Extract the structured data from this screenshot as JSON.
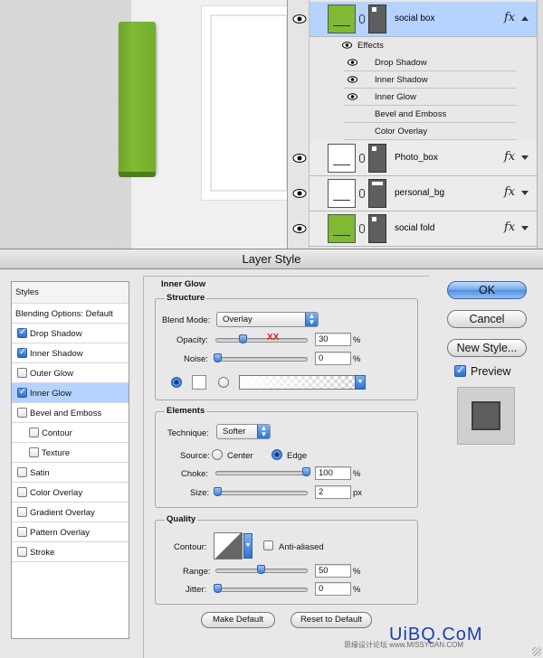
{
  "layers": {
    "rows": [
      {
        "name": "social box",
        "selected": true,
        "thumb": "green",
        "mask": "default",
        "fx": true,
        "arrow": "up"
      },
      {
        "name": "Photo_box",
        "selected": false,
        "thumb": "white",
        "mask": "default",
        "fx": true,
        "arrow": "down"
      },
      {
        "name": "personal_bg",
        "selected": false,
        "thumb": "white",
        "mask": "bg",
        "fx": true,
        "arrow": "down"
      },
      {
        "name": "social fold",
        "selected": false,
        "thumb": "green",
        "mask": "default",
        "fx": true,
        "arrow": "down"
      }
    ],
    "effects_label": "Effects",
    "effects": [
      "Drop Shadow",
      "Inner Shadow",
      "Inner Glow",
      "Bevel and Emboss",
      "Color Overlay"
    ],
    "fx_label": "fx"
  },
  "dialog": {
    "title": "Layer Style",
    "styles_header": "Styles",
    "blending_options": "Blending Options: Default",
    "styles": [
      {
        "label": "Drop Shadow",
        "checked": true,
        "indent": false
      },
      {
        "label": "Inner Shadow",
        "checked": true,
        "indent": false
      },
      {
        "label": "Outer Glow",
        "checked": false,
        "indent": false
      },
      {
        "label": "Inner Glow",
        "checked": true,
        "indent": false,
        "selected": true
      },
      {
        "label": "Bevel and Emboss",
        "checked": false,
        "indent": false
      },
      {
        "label": "Contour",
        "checked": false,
        "indent": true
      },
      {
        "label": "Texture",
        "checked": false,
        "indent": true
      },
      {
        "label": "Satin",
        "checked": false,
        "indent": false
      },
      {
        "label": "Color Overlay",
        "checked": false,
        "indent": false
      },
      {
        "label": "Gradient Overlay",
        "checked": false,
        "indent": false
      },
      {
        "label": "Pattern Overlay",
        "checked": false,
        "indent": false
      },
      {
        "label": "Stroke",
        "checked": false,
        "indent": false
      }
    ],
    "pane_title": "Inner Glow",
    "structure": {
      "title": "Structure",
      "blend_mode_label": "Blend Mode:",
      "blend_mode": "Overlay",
      "opacity_label": "Opacity:",
      "opacity": "30",
      "opacity_level": 0.3,
      "noise_label": "Noise:",
      "noise": "0",
      "noise_level": 0,
      "unit": "%"
    },
    "elements": {
      "title": "Elements",
      "technique_label": "Technique:",
      "technique": "Softer",
      "source_label": "Source:",
      "source_center": "Center",
      "source_edge": "Edge",
      "choke_label": "Choke:",
      "choke": "100",
      "choke_level": 1.0,
      "size_label": "Size:",
      "size": "2",
      "size_level": 0.01,
      "pct": "%",
      "px": "px"
    },
    "quality": {
      "title": "Quality",
      "contour_label": "Contour:",
      "anti_aliased": "Anti-aliased",
      "range_label": "Range:",
      "range": "50",
      "range_level": 0.5,
      "jitter_label": "Jitter:",
      "jitter": "0",
      "jitter_level": 0,
      "unit": "%"
    },
    "make_default": "Make Default",
    "reset_default": "Reset to Default",
    "ok": "OK",
    "cancel": "Cancel",
    "new_style": "New Style...",
    "preview": "Preview"
  },
  "watermark": {
    "text": "UiBQ.CoM",
    "sub": "思缘设计论坛 www.MISSYUAN.COM"
  },
  "overlay": "XX"
}
